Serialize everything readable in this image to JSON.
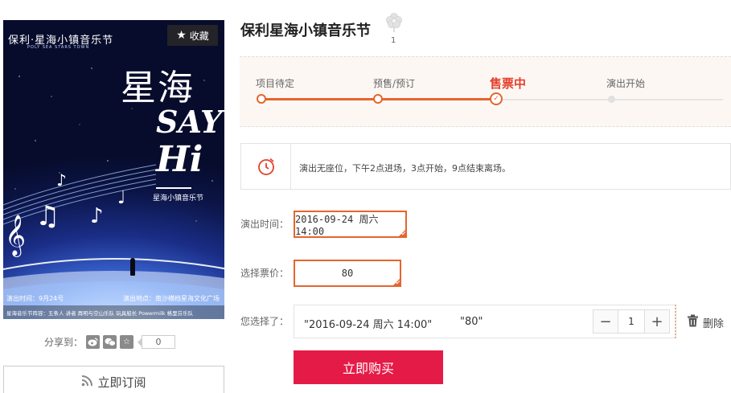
{
  "poster": {
    "brand": "保利·星海小镇音乐节",
    "brand_sub": "POLY SEA STARS TOWN",
    "favorite_label": "收藏",
    "headline": "星海",
    "say": "SAY",
    "hi": "Hi",
    "festival_small": "星海小镇音乐节",
    "show_time": "演出时间：9月24号",
    "show_place": "演出地点：南沙横档星海文化广场",
    "lineup": "星海音乐节阵容：五条人  讲者  再明与空山乐队  玩具船长  Powermilk  格里芬乐队"
  },
  "share": {
    "label": "分享到：",
    "icons": [
      "weibo-icon",
      "wechat-icon",
      "favorite-star-icon"
    ],
    "count": "0"
  },
  "subscribe_label": "立即订阅",
  "event": {
    "title": "保利星海小镇音乐节",
    "flower_count": "1"
  },
  "progress": {
    "stages": [
      "项目待定",
      "预售/预订",
      "售票中",
      "演出开始"
    ],
    "current_index": 2
  },
  "notice": {
    "text": "演出无座位，下午2点进场，3点开始，9点结束离场。"
  },
  "form": {
    "time_label": "演出时间：",
    "time_value": "2016-09-24 周六 14:00",
    "price_label": "选择票价：",
    "price_value": "80",
    "chosen_label": "您选择了：",
    "chosen_date": "\"2016-09-24 周六 14:00\"",
    "chosen_price": "\"80\"",
    "quantity": "1",
    "minus": "−",
    "plus": "+",
    "delete_label": "删除",
    "buy_label": "立即购买"
  },
  "colors": {
    "accent": "#e4652d",
    "buy": "#e51b47",
    "current_stage": "#e4412d"
  }
}
